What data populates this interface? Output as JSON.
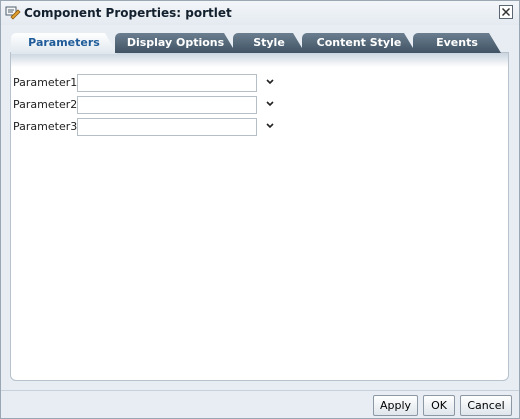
{
  "window": {
    "title": "Component Properties: portlet",
    "icon": "properties-icon"
  },
  "tabs": [
    {
      "label": "Parameters",
      "active": true
    },
    {
      "label": "Display Options",
      "active": false
    },
    {
      "label": "Style",
      "active": false
    },
    {
      "label": "Content Style",
      "active": false
    },
    {
      "label": "Events",
      "active": false
    }
  ],
  "parameters": [
    {
      "label": "Parameter1",
      "value": ""
    },
    {
      "label": "Parameter2",
      "value": ""
    },
    {
      "label": "Parameter3",
      "value": ""
    }
  ],
  "buttons": {
    "apply": "Apply",
    "ok": "OK",
    "cancel": "Cancel"
  },
  "colors": {
    "active_tab_text": "#1f5b99",
    "inactive_tab_bg": "#405364"
  }
}
